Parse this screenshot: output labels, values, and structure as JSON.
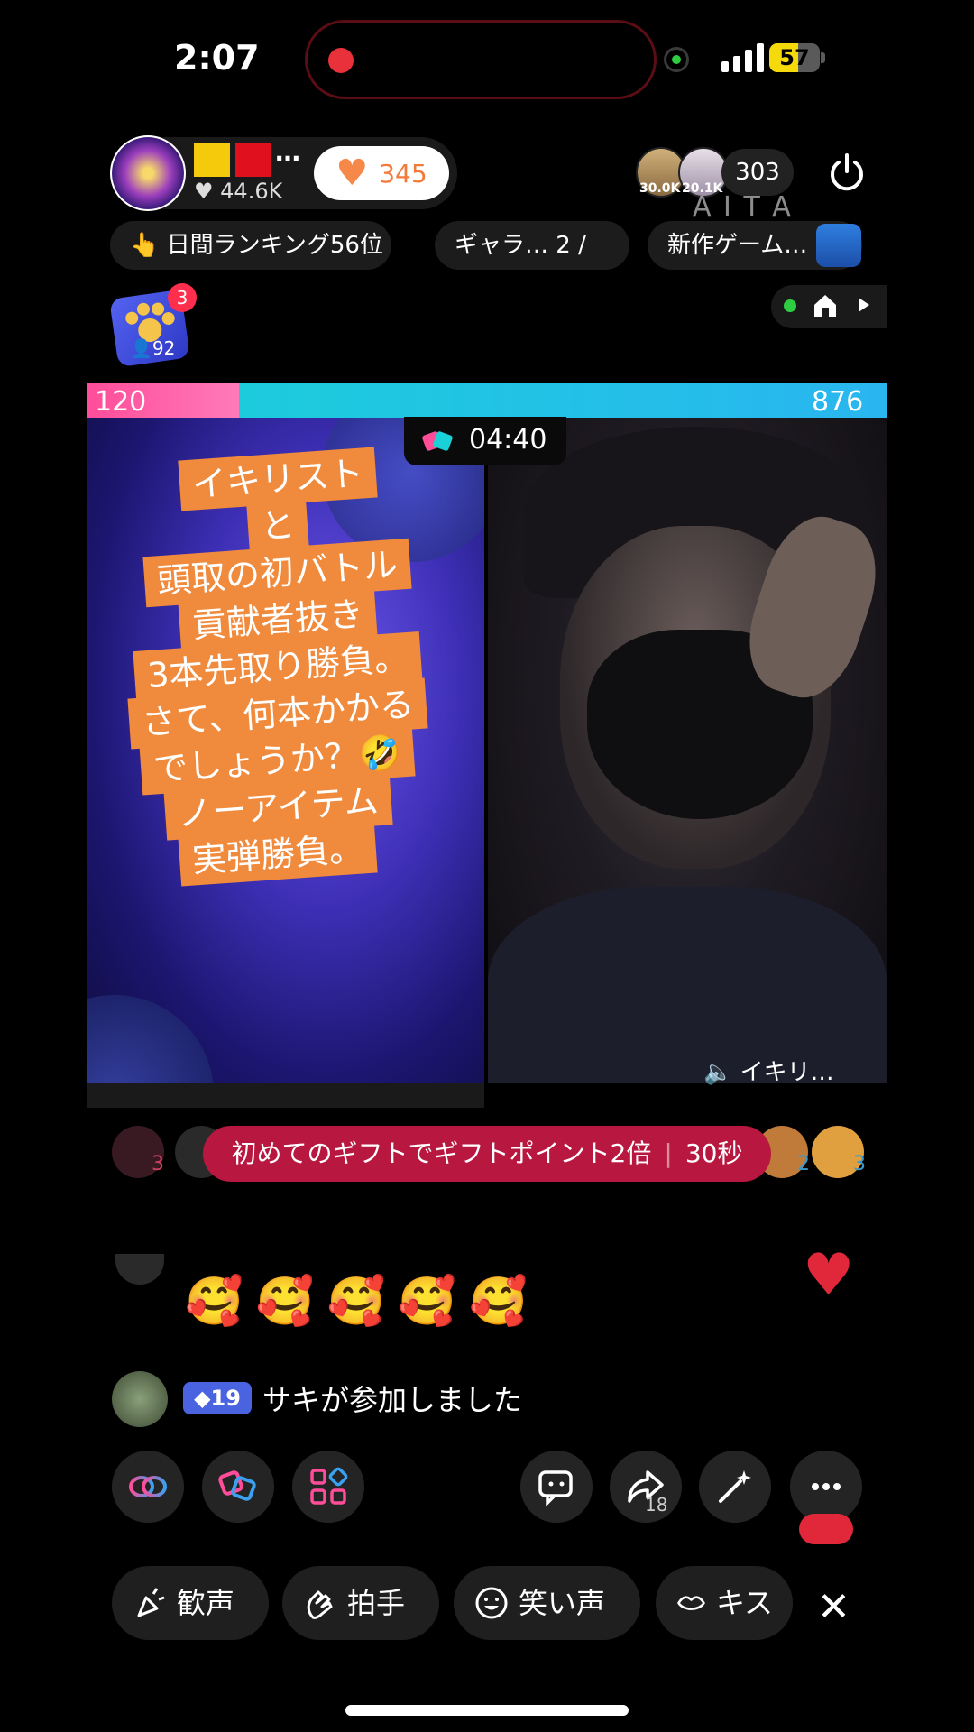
{
  "status_bar": {
    "time": "2:07",
    "battery": "57"
  },
  "host": {
    "likes": "44.6K",
    "more": "…",
    "like_count": "345"
  },
  "viewers": {
    "top1": "30.0K",
    "top2": "20.1K",
    "count": "303"
  },
  "watermark": "A I T A",
  "info_pills": {
    "ranking": "👆 日間ランキング56位",
    "gallery": "ギャラ…  2  /",
    "new_game": "新作ゲーム…"
  },
  "paw": {
    "badge": "3",
    "count": "92"
  },
  "battle": {
    "score_left": "120",
    "score_right": "876",
    "timer": "04:40"
  },
  "overlay_lines": [
    "イキリスト",
    "と",
    "頭取の初バトル",
    "貢献者抜き",
    "3本先取り勝負。",
    "さて、何本かかる",
    "でしょうか？🤣",
    "ノーアイテム",
    "実弾勝負。"
  ],
  "opponent_label": "イキリ…",
  "gift_banner": {
    "text": "初めてのギフトでギフトポイント2倍",
    "time": "30秒"
  },
  "contributors": {
    "left_rank": "3",
    "right_rank_a": "2",
    "right_rank_b": "3"
  },
  "comments": {
    "emojis": "🥰🥰🥰🥰🥰",
    "join_level": "19",
    "join_text": "サキが参加しました"
  },
  "toolbar": {
    "share_count": "18"
  },
  "reactions": [
    "歓声",
    "拍手",
    "笑い声",
    "キス"
  ],
  "close": "✕",
  "colors": {
    "accent_pink": "#ff4d9a",
    "accent_cyan": "#19d1d7",
    "overlay_orange": "#f08a3c",
    "gift_red": "#b8173f"
  }
}
